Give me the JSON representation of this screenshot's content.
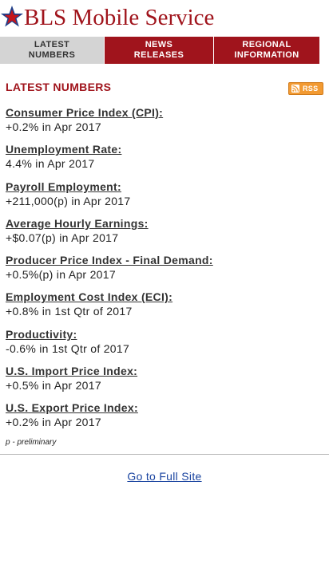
{
  "header": {
    "title": "BLS Mobile Service",
    "logo_icon": "bls-star-logo-icon"
  },
  "tabs": [
    {
      "line1": "LATEST",
      "line2": "NUMBERS"
    },
    {
      "line1": "NEWS",
      "line2": "RELEASES"
    },
    {
      "line1": "REGIONAL",
      "line2": "INFORMATION"
    }
  ],
  "section": {
    "title": "LATEST NUMBERS",
    "rss_label": "RSS"
  },
  "stats": [
    {
      "name": "Consumer Price Index (CPI):",
      "value": "+0.2% in Apr 2017"
    },
    {
      "name": "Unemployment Rate:",
      "value": "4.4% in Apr 2017"
    },
    {
      "name": "Payroll Employment:",
      "value": "+211,000(p) in Apr 2017"
    },
    {
      "name": "Average Hourly Earnings:",
      "value": "+$0.07(p) in Apr 2017"
    },
    {
      "name": "Producer Price Index - Final Demand:",
      "value": "+0.5%(p) in Apr 2017"
    },
    {
      "name": "Employment Cost Index (ECI):",
      "value": "+0.8% in 1st Qtr of 2017"
    },
    {
      "name": "Productivity:",
      "value": "-0.6% in 1st Qtr of 2017"
    },
    {
      "name": "U.S. Import Price Index:",
      "value": "+0.5% in Apr 2017"
    },
    {
      "name": "U.S. Export Price Index:",
      "value": "+0.2% in Apr 2017"
    }
  ],
  "footnote": "p - preliminary",
  "full_site_link": "Go to Full Site",
  "colors": {
    "brand_red": "#a0141c",
    "tab_inactive": "#d4d4d4",
    "link_blue": "#1a44a0",
    "rss_orange": "#f29a32"
  }
}
